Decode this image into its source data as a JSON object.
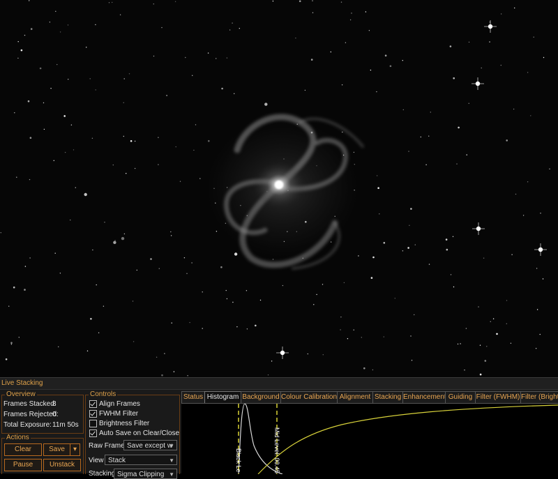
{
  "panel": {
    "title": "Live Stacking"
  },
  "overview": {
    "label": "Overview",
    "frames_stacked_label": "Frames Stacked:",
    "frames_stacked_value": "8",
    "frames_rejected_label": "Frames Rejected:",
    "frames_rejected_value": "0",
    "total_exposure_label": "Total Exposure:",
    "total_exposure_value": "11m 50s"
  },
  "actions": {
    "label": "Actions",
    "clear": "Clear",
    "save": "Save",
    "save_dropdown": "▾",
    "pause": "Pause",
    "unstack": "Unstack"
  },
  "controls": {
    "label": "Controls",
    "align_frames": {
      "label": "Align Frames",
      "checked": true
    },
    "fwhm_filter": {
      "label": "FWHM Filter",
      "checked": true
    },
    "brightness_filter": {
      "label": "Brightness Filter",
      "checked": false
    },
    "auto_save": {
      "label": "Auto Save on Clear/Close",
      "checked": true
    },
    "raw_frames_label": "Raw Frames",
    "raw_frames_value": "Save except w",
    "view_label": "View",
    "view_value": "Stack",
    "stacking_label": "Stacking",
    "stacking_value": "Sigma Clipping"
  },
  "tabs": [
    {
      "label": "Status",
      "active": false
    },
    {
      "label": "Histogram",
      "active": true
    },
    {
      "label": "Background",
      "active": false
    },
    {
      "label": "Colour Calibration",
      "active": false
    },
    {
      "label": "Alignment",
      "active": false
    },
    {
      "label": "Stacking",
      "active": false
    },
    {
      "label": "Enhancement",
      "active": false
    },
    {
      "label": "Guiding",
      "active": false
    },
    {
      "label": "Filter (FWHM)",
      "active": false
    },
    {
      "label": "Filter (Brightness)",
      "active": false
    }
  ],
  "histogram": {
    "black_level_label": "Black Le",
    "mid_level_label": "Mid Level: 00.45"
  },
  "colors": {
    "accent": "#e9a652",
    "border": "#6a3d14",
    "level_line": "#e8e23a",
    "curve": "#d8d23a"
  }
}
